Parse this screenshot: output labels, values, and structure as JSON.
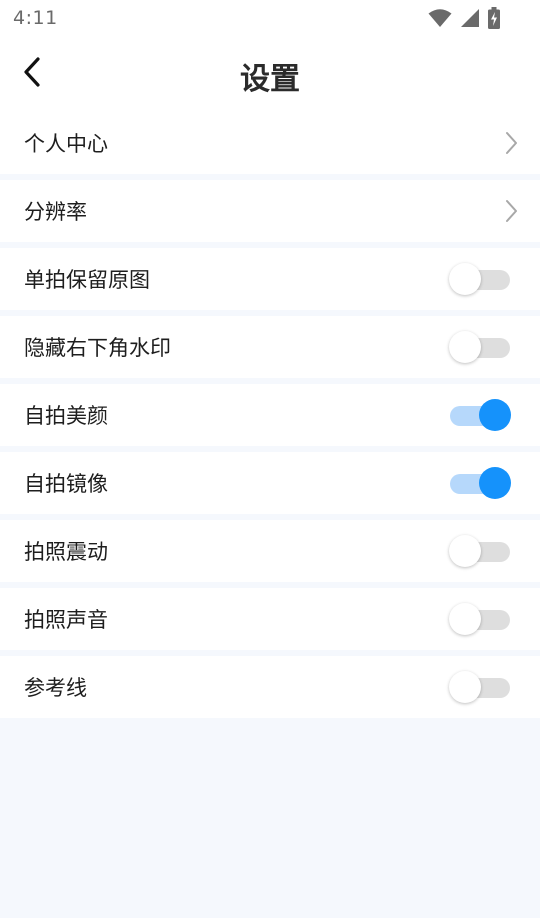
{
  "status_bar": {
    "time": "4:11",
    "icons": [
      "wifi-icon",
      "signal-icon",
      "battery-charging-icon"
    ]
  },
  "header": {
    "title": "设置",
    "back_icon": "chevron-left-icon"
  },
  "colors": {
    "accent": "#1592fb",
    "accent_track": "#b6d8fb",
    "off_track": "#dedede",
    "page_background": "#f5f8fd"
  },
  "settings": [
    {
      "label": "个人中心",
      "type": "link"
    },
    {
      "label": "分辨率",
      "type": "link"
    },
    {
      "label": "单拍保留原图",
      "type": "toggle",
      "on": false
    },
    {
      "label": "隐藏右下角水印",
      "type": "toggle",
      "on": false
    },
    {
      "label": "自拍美颜",
      "type": "toggle",
      "on": true
    },
    {
      "label": "自拍镜像",
      "type": "toggle",
      "on": true
    },
    {
      "label": "拍照震动",
      "type": "toggle",
      "on": false
    },
    {
      "label": "拍照声音",
      "type": "toggle",
      "on": false
    },
    {
      "label": "参考线",
      "type": "toggle",
      "on": false
    }
  ]
}
